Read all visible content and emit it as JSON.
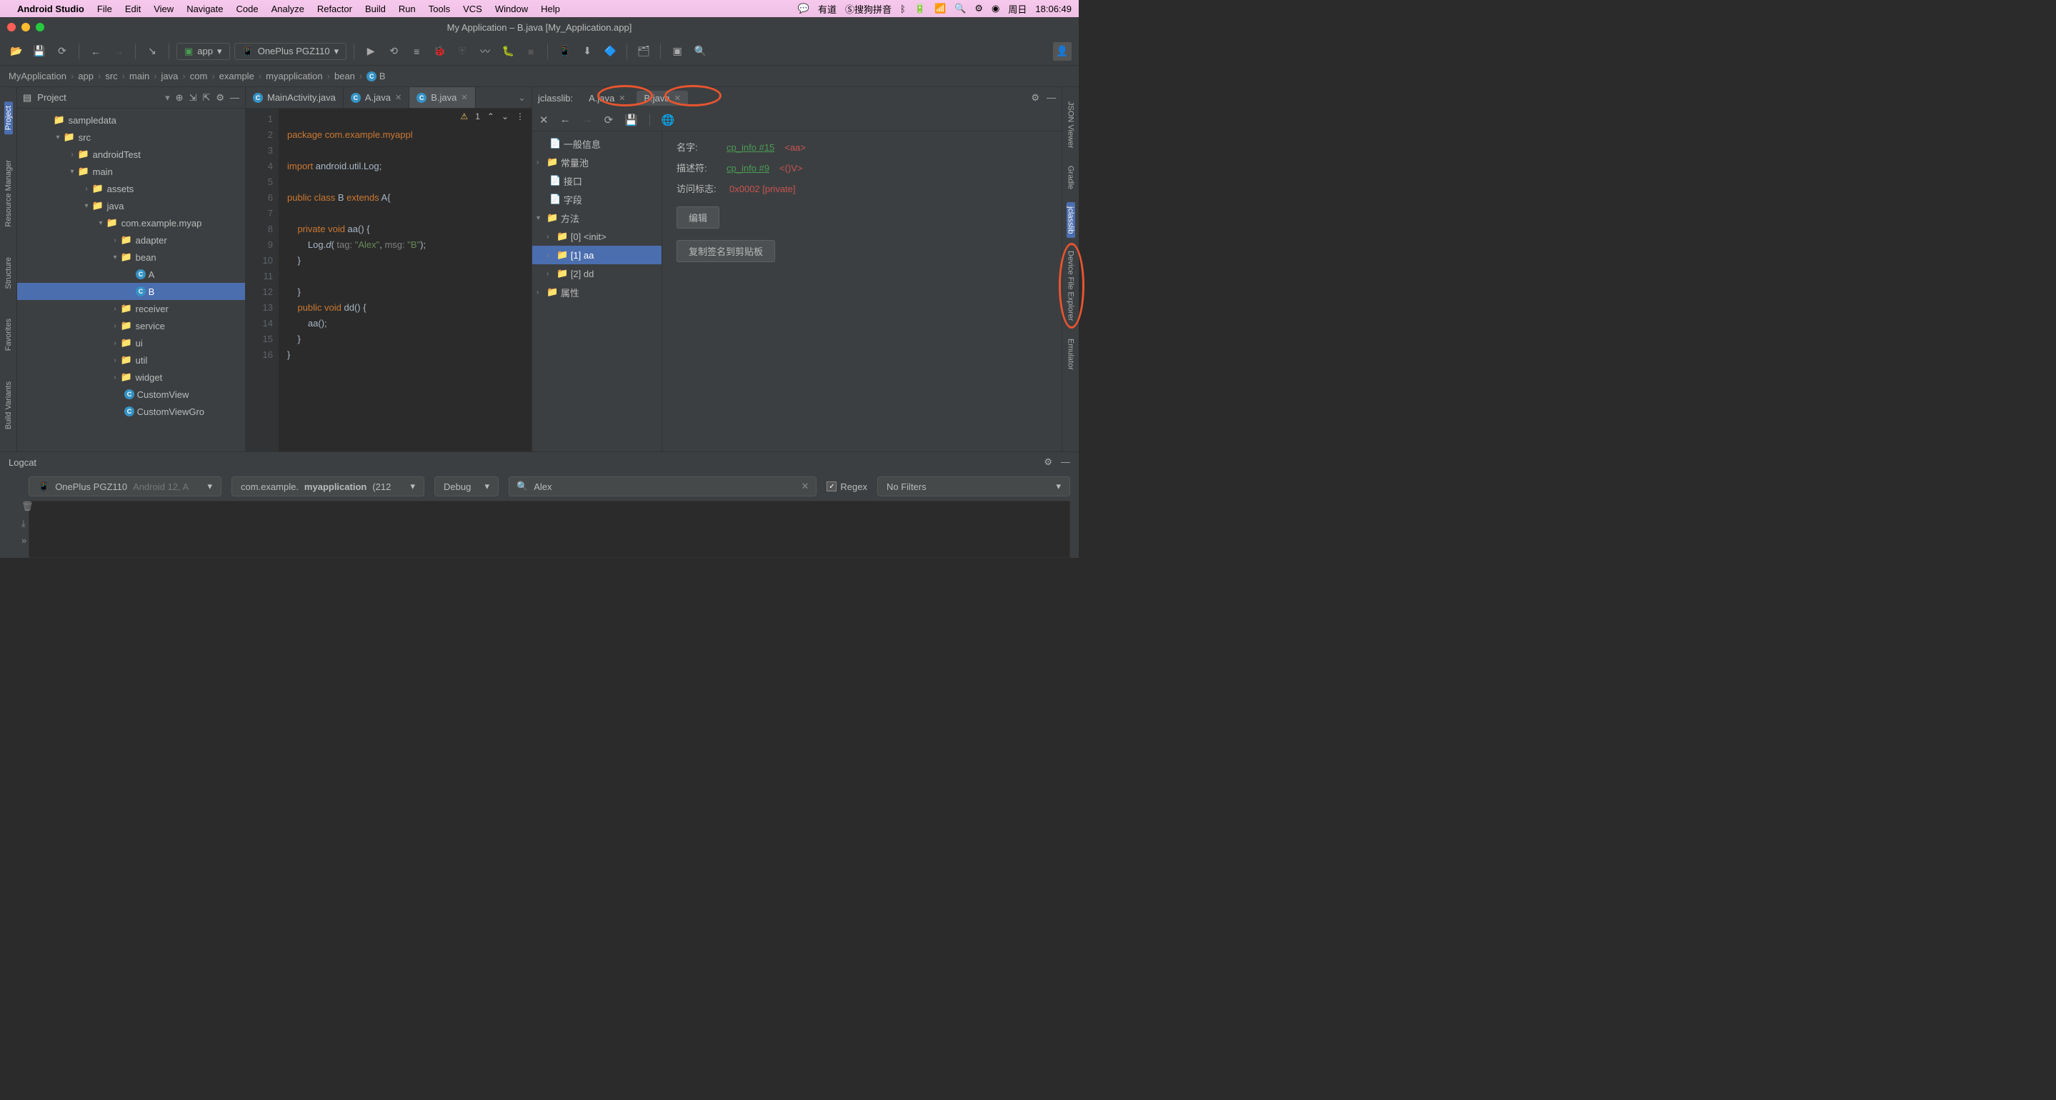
{
  "mac_menu": {
    "app": "Android Studio",
    "items": [
      "File",
      "Edit",
      "View",
      "Navigate",
      "Code",
      "Analyze",
      "Refactor",
      "Build",
      "Run",
      "Tools",
      "VCS",
      "Window",
      "Help"
    ],
    "right": {
      "ime1": "有道",
      "ime2": "搜狗拼音",
      "day": "周日",
      "time": "18:06:49"
    }
  },
  "window_title": "My Application – B.java [My_Application.app]",
  "toolbar": {
    "config": "app",
    "device": "OnePlus PGZ110"
  },
  "breadcrumbs": [
    "MyApplication",
    "app",
    "src",
    "main",
    "java",
    "com",
    "example",
    "myapplication",
    "bean",
    "B"
  ],
  "project_panel": {
    "title": "Project",
    "tree": {
      "sampledata": "sampledata",
      "src": "src",
      "androidTest": "androidTest",
      "main": "main",
      "assets": "assets",
      "java": "java",
      "pkg": "com.example.myap",
      "adapter": "adapter",
      "bean": "bean",
      "A": "A",
      "B": "B",
      "receiver": "receiver",
      "service": "service",
      "ui": "ui",
      "util": "util",
      "widget": "widget",
      "CustomView": "CustomView",
      "CustomViewGroup": "CustomViewGro"
    }
  },
  "editor": {
    "tabs": [
      "MainActivity.java",
      "A.java",
      "B.java"
    ],
    "warnings": "1",
    "code": {
      "l1": "package com.example.myappl",
      "l3a": "import",
      "l3b": " android.util.Log;",
      "l5a": "public class ",
      "l5b": "B ",
      "l5c": "extends ",
      "l5d": "A{",
      "l7a": "private void ",
      "l7b": "aa() {",
      "l8a": "Log.",
      "l8b": "d",
      "l8c": "( ",
      "l8d": "tag:",
      "l8e": " \"Alex\"",
      "l8f": ", ",
      "l8g": "msg:",
      "l8h": " \"B\"",
      "l8i": ");",
      "l9": "}",
      "l11": "}",
      "l12a": "public void ",
      "l12b": "dd() {",
      "l13": "aa();",
      "l14": "}",
      "l15": "}"
    }
  },
  "jclasslib": {
    "label": "jclasslib:",
    "tabs": [
      "A.java",
      "B.java"
    ],
    "tree": {
      "general": "一般信息",
      "constpool": "常量池",
      "interfaces": "接口",
      "fields": "字段",
      "methods": "方法",
      "m0": "[0] <init>",
      "m1": "[1] aa",
      "m2": "[2] dd",
      "attrs": "属性"
    },
    "detail": {
      "name_lbl": "名字:",
      "name_lnk": "cp_info #15",
      "name_val": "<aa>",
      "desc_lbl": "描述符:",
      "desc_lnk": "cp_info #9",
      "desc_val": "<()V>",
      "access_lbl": "访问标志:",
      "access_val": "0x0002 [private]",
      "btn_edit": "编辑",
      "btn_copy": "复制签名到剪贴板"
    }
  },
  "logcat": {
    "title": "Logcat",
    "device": "OnePlus PGZ110",
    "device_sub": "Android 12, A",
    "process": "com.example.",
    "process_bold": "myapplication",
    "process_suffix": " (212",
    "level": "Debug",
    "search": "Alex",
    "regex": "Regex",
    "filter": "No Filters"
  },
  "side_tools": {
    "left": [
      "Project",
      "Resource Manager",
      "Structure",
      "Favorites",
      "Build Variants"
    ],
    "right": [
      "JSON Viewer",
      "Gradle",
      "jclasslib",
      "Device File Explorer",
      "Emulator"
    ]
  }
}
